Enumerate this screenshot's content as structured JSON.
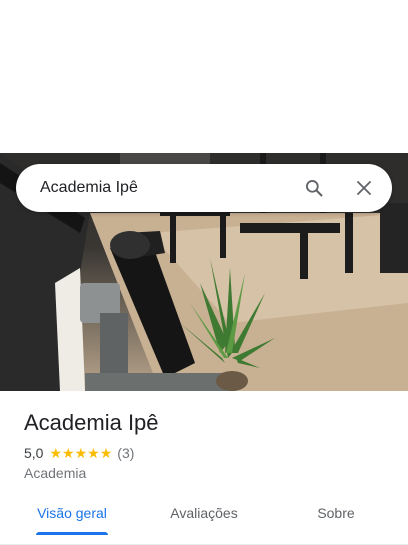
{
  "search": {
    "query": "Academia Ipê"
  },
  "place": {
    "name": "Academia Ipê",
    "rating": "5,0",
    "stars": 5,
    "review_count": "(3)",
    "category": "Academia"
  },
  "tabs": [
    {
      "label": "Visão geral",
      "active": true
    },
    {
      "label": "Avaliações",
      "active": false
    },
    {
      "label": "Sobre",
      "active": false
    }
  ],
  "colors": {
    "accent": "#1a73e8",
    "star": "#fbbc04"
  },
  "icons": [
    "search-icon",
    "close-icon",
    "star-icon"
  ]
}
